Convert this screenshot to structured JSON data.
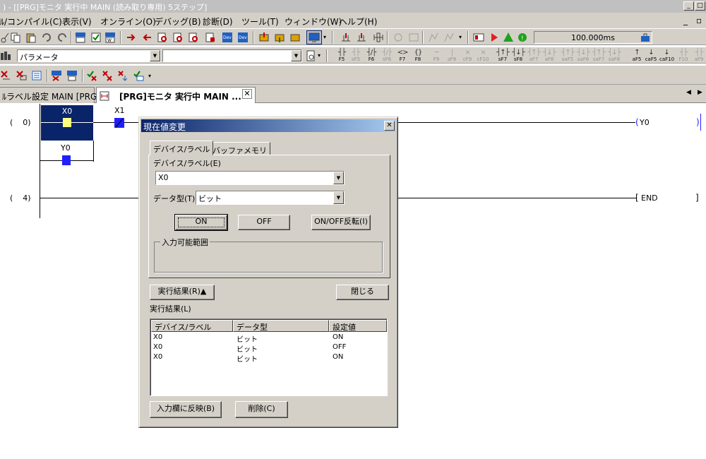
{
  "window": {
    "title": ") - [[PRG]モニタ 実行中 MAIN (読み取り専用) 5ステップ]"
  },
  "menu": {
    "items": [
      "ﾙ/コンパイル(C)",
      "表示(V)",
      "オンライン(O)",
      "デバッグ(B)",
      "診断(D)",
      "ツール(T)",
      "ウィンドウ(W)",
      "ヘルプ(H)"
    ]
  },
  "toolbar": {
    "scan_time": "100.000ms",
    "parameter_combo": "パラメータ"
  },
  "fkeys": [
    {
      "g": "┤├",
      "k": "F5",
      "dim": false
    },
    {
      "g": "┤├",
      "k": "sF5",
      "dim": true
    },
    {
      "g": "┤/├",
      "k": "F6",
      "dim": false
    },
    {
      "g": "┤/├",
      "k": "sF6",
      "dim": true
    },
    {
      "g": "<>",
      "k": "F7",
      "dim": false
    },
    {
      "g": "{}",
      "k": "F8",
      "dim": false
    },
    {
      "g": "─",
      "k": "F9",
      "dim": true
    },
    {
      "g": "|",
      "k": "sF9",
      "dim": true
    },
    {
      "g": "×",
      "k": "cF9",
      "dim": true
    },
    {
      "g": "×",
      "k": "cF10",
      "dim": true
    },
    {
      "g": "┤↑├",
      "k": "sF7",
      "dim": false
    },
    {
      "g": "┤↓├",
      "k": "sF8",
      "dim": false
    },
    {
      "g": "┤↑├",
      "k": "aF7",
      "dim": true
    },
    {
      "g": "┤↓├",
      "k": "aF8",
      "dim": true
    },
    {
      "g": "┤↑├",
      "k": "saF5",
      "dim": true
    },
    {
      "g": "┤↓├",
      "k": "saF6",
      "dim": true
    },
    {
      "g": "┤↑├",
      "k": "saF7",
      "dim": true
    },
    {
      "g": "┤↓├",
      "k": "saF8",
      "dim": true
    },
    {
      "g": "↑",
      "k": "aF5",
      "dim": false
    },
    {
      "g": "↓",
      "k": "caF5",
      "dim": false
    },
    {
      "g": "↓",
      "k": "caF10",
      "dim": false
    },
    {
      "g": "┤├",
      "k": "F10",
      "dim": true
    },
    {
      "g": "┤├",
      "k": "aF9",
      "dim": true
    }
  ],
  "tabs": [
    {
      "label": "ﾙラベル設定 MAIN [PRG]"
    },
    {
      "label": "[PRG]モニタ 実行中 MAIN ..."
    }
  ],
  "ladder": {
    "step0": "(    0)",
    "step4": "(    4)",
    "x0": "X0",
    "x1": "X1",
    "y0_contact": "Y0",
    "y0_coil": "Y0",
    "end": "END"
  },
  "dialog": {
    "title": "現在値変更",
    "tab_device": "デバイス/ラベル",
    "tab_buffer": "バッファメモリ",
    "device_label": "デバイス/ラベル(E)",
    "device_value": "X0",
    "datatype_label": "データ型(T)",
    "datatype_value": "ビット",
    "on_button": "ON",
    "off_button": "OFF",
    "toggle_button": "ON/OFF反転(I)",
    "range_group": "入力可能範囲",
    "result_toggle": "実行結果(R)▲",
    "close_button": "閉じる",
    "result_label": "実行結果(L)",
    "columns": [
      "デバイス/ラベル",
      "データ型",
      "設定値"
    ],
    "rows": [
      [
        "X0",
        "ビット",
        "ON"
      ],
      [
        "X0",
        "ビット",
        "OFF"
      ],
      [
        "X0",
        "ビット",
        "ON"
      ]
    ],
    "apply_button": "入力欄に反映(B)",
    "delete_button": "削除(C)"
  }
}
